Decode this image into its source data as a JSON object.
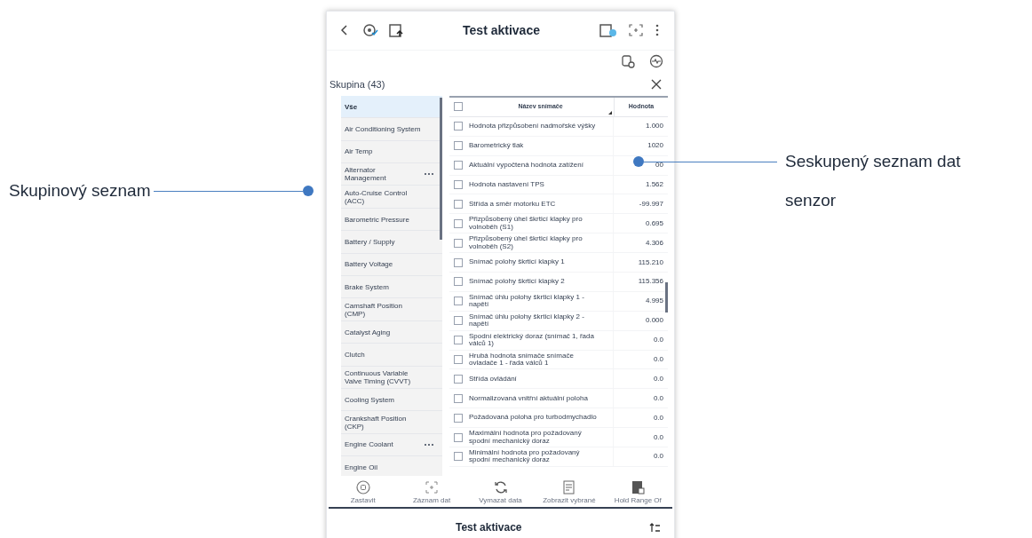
{
  "header": {
    "title": "Test aktivace"
  },
  "group_panel": {
    "title": "Skupina (43)"
  },
  "groups": [
    {
      "label": "Vše",
      "selected": true,
      "more": false
    },
    {
      "label": "Air Conditioning System",
      "selected": false,
      "more": false
    },
    {
      "label": "Air Temp",
      "selected": false,
      "more": false
    },
    {
      "label": "Alternator Management",
      "selected": false,
      "more": true
    },
    {
      "label": "Auto-Cruise Control (ACC)",
      "selected": false,
      "more": false
    },
    {
      "label": "Barometric Pressure",
      "selected": false,
      "more": false
    },
    {
      "label": "Battery / Supply",
      "selected": false,
      "more": false
    },
    {
      "label": "Battery Voltage",
      "selected": false,
      "more": false
    },
    {
      "label": "Brake System",
      "selected": false,
      "more": false
    },
    {
      "label": "Camshaft Position (CMP)",
      "selected": false,
      "more": false
    },
    {
      "label": "Catalyst Aging",
      "selected": false,
      "more": false
    },
    {
      "label": "Clutch",
      "selected": false,
      "more": false
    },
    {
      "label": "Continuous Variable Valve Timing (CVVT)",
      "selected": false,
      "more": false
    },
    {
      "label": "Cooling System",
      "selected": false,
      "more": false
    },
    {
      "label": "Crankshaft Position (CKP)",
      "selected": false,
      "more": false
    },
    {
      "label": "Engine Coolant",
      "selected": false,
      "more": true
    },
    {
      "label": "Engine Oil",
      "selected": false,
      "more": false
    }
  ],
  "table": {
    "columns": [
      "Název snímače",
      "Hodnota"
    ],
    "select_all_checked": false,
    "rows": [
      {
        "name": "Hodnota přizpůsobení nadmořské výšky",
        "value": "1.000",
        "checked": false
      },
      {
        "name": "Barometrický tlak",
        "value": "1020",
        "checked": false
      },
      {
        "name": "Aktuální vypočtená hodnota zatížení",
        "value": "00",
        "checked": false
      },
      {
        "name": "Hodnota nastavení TPS",
        "value": "1.562",
        "checked": false
      },
      {
        "name": "Střída a směr motorku ETC",
        "value": "-99.997",
        "checked": false
      },
      {
        "name": "Přizpůsobený úhel škrticí klapky pro volnoběh (S1)",
        "value": "0.695",
        "checked": false
      },
      {
        "name": "Přizpůsobený úhel škrticí klapky pro volnoběh (S2)",
        "value": "4.306",
        "checked": false
      },
      {
        "name": "Snímač polohy škrticí klapky 1",
        "value": "115.210",
        "checked": false
      },
      {
        "name": "Snímač polohy škrticí klapky 2",
        "value": "115.356",
        "checked": false
      },
      {
        "name": "Snímač úhlu polohy škrticí klapky 1 - napětí",
        "value": "4.995",
        "checked": false
      },
      {
        "name": "Snímač úhlu polohy škrticí klapky 2 - napětí",
        "value": "0.000",
        "checked": false
      },
      {
        "name": "Spodní elektrický doraz (snímač 1, řada válců 1)",
        "value": "0.0",
        "checked": false
      },
      {
        "name": "Hrubá hodnota snímače snímače ovladače 1 - řada válců 1",
        "value": "0.0",
        "checked": false
      },
      {
        "name": "Střída ovládání",
        "value": "0.0",
        "checked": false
      },
      {
        "name": "Normalizovaná vnitřní aktuální poloha",
        "value": "0.0",
        "checked": false
      },
      {
        "name": "Požadovaná poloha pro turbodmychadlo",
        "value": "0.0",
        "checked": false
      },
      {
        "name": "Maximální hodnota pro požadovaný spodní mechanický doraz",
        "value": "0.0",
        "checked": false
      },
      {
        "name": "Minimální hodnota pro požadovaný spodní mechanický doraz",
        "value": "0.0",
        "checked": false
      }
    ]
  },
  "toolbar": [
    {
      "kind": "stop",
      "label": "Zastavit"
    },
    {
      "kind": "record",
      "label": "Záznam dat"
    },
    {
      "kind": "clear",
      "label": "Vymazat data"
    },
    {
      "kind": "show",
      "label": "Zobrazit vybrané"
    },
    {
      "kind": "hold",
      "label": "Hold Range Of"
    }
  ],
  "footer": {
    "title": "Test aktivace"
  },
  "callouts": [
    {
      "text": "Skupinový seznam"
    },
    {
      "text": "Seskupený seznam dat senzor"
    }
  ]
}
